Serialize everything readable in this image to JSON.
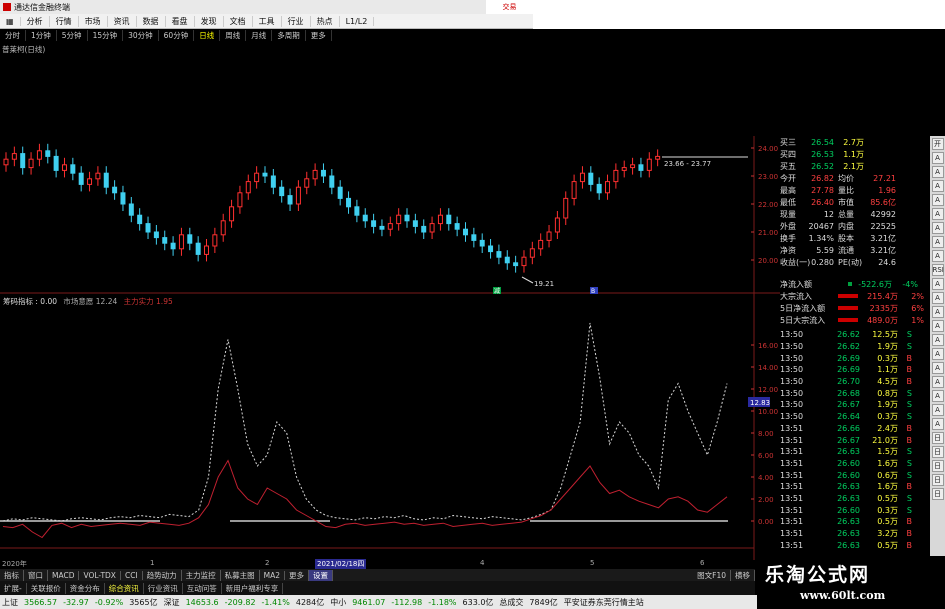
{
  "titlebar": {
    "title": "通达信金融终端"
  },
  "menu": {
    "items": [
      "分析",
      "行情",
      "市场",
      "资讯",
      "数据",
      "看盘",
      "发现",
      "文档",
      "工具",
      "行业",
      "热点",
      "L1/L2"
    ],
    "brand": "交易"
  },
  "periods": {
    "items": [
      "分时",
      "1分钟",
      "5分钟",
      "15分钟",
      "30分钟",
      "60分钟",
      "日线",
      "周线",
      "月线",
      "多周期",
      "更多"
    ],
    "active": 6
  },
  "stock": {
    "name": "普莱柯(日线)"
  },
  "kline": {
    "price_axis": [
      "24.00",
      "23.00",
      "22.00",
      "21.00",
      "20.00"
    ],
    "high_label": "23.66 - 23.77",
    "low_label": "19.21",
    "low_marker": "减",
    "event_marker": "B"
  },
  "indicator": {
    "name": "筹码指标",
    "v0_label": ": 0.00",
    "m1_label": "市场意愿 12.24",
    "m2_label": "主力实力 1.95",
    "axis": [
      "16.00",
      "14.00",
      "12.00",
      "10.00",
      "8.00",
      "6.00",
      "4.00",
      "2.00",
      "0.00"
    ],
    "current": "12.83",
    "chart_data": {
      "type": "line",
      "series": [
        {
          "name": "市场意愿",
          "values": [
            0,
            0.2,
            0.1,
            0.3,
            0.2,
            0.1,
            0,
            0.2,
            0.3,
            0.2,
            0.1,
            0.3,
            0.4,
            0.3,
            0.5,
            0.4,
            0.3,
            0.6,
            0.5,
            0.4,
            1.0,
            4.0,
            12.0,
            16.5,
            12.0,
            7.0,
            5.0,
            6.0,
            9.0,
            8.0,
            4.0,
            2.0,
            1.0,
            0.5,
            0.3,
            0.2,
            0.1,
            0.3,
            0.2,
            0.4,
            0.3,
            0.5,
            0.2,
            0.1,
            0.3,
            0.2,
            0.5,
            0.4,
            0.3,
            0.2,
            0.4,
            0.3,
            0.2,
            0.1,
            0.3,
            0.6,
            1.0,
            3.0,
            6.0,
            9.0,
            18.0,
            13.0,
            7.0,
            9.0,
            8.0,
            6.0,
            5.0,
            3.0,
            11.0,
            12.5,
            10.0,
            8.0,
            6.0,
            9.0,
            12.5
          ]
        },
        {
          "name": "主力实力",
          "values": [
            -0.5,
            -0.6,
            -0.3,
            -1.0,
            -1.5,
            -0.4,
            -0.2,
            -0.6,
            -0.3,
            -0.5,
            -0.4,
            -0.3,
            -0.2,
            -0.3,
            -0.4,
            -0.1,
            -0.2,
            -0.3,
            -0.4,
            -0.2,
            0.3,
            1.5,
            4.0,
            5.5,
            3.0,
            2.0,
            1.5,
            3.0,
            2.5,
            2.0,
            1.0,
            0.5,
            0.0,
            -0.5,
            -0.6,
            -0.3,
            -0.2,
            -0.4,
            -0.3,
            -0.2,
            -0.1,
            -0.3,
            -0.2,
            -0.4,
            -0.3,
            -0.2,
            -0.5,
            -0.4,
            -0.3,
            -0.2,
            -0.4,
            -0.3,
            -0.2,
            -0.1,
            0.2,
            0.5,
            1.0,
            2.0,
            3.0,
            4.0,
            5.0,
            3.5,
            2.5,
            2.8,
            2.2,
            1.8,
            1.5,
            1.2,
            2.0,
            2.2,
            1.8,
            1.0,
            0.8,
            1.5,
            2.2
          ]
        }
      ],
      "ylim": [
        -2,
        18
      ]
    }
  },
  "quote": {
    "rows": [
      {
        "l": "买三",
        "v1": "26.54",
        "v2": "2.7万"
      },
      {
        "l": "买四",
        "v1": "26.53",
        "v2": "1.1万"
      },
      {
        "l": "买五",
        "v1": "26.52",
        "v2": "2.1万"
      }
    ],
    "stats": [
      {
        "l1": "今开",
        "v1": "26.82",
        "l2": "均价",
        "v2": "27.21"
      },
      {
        "l1": "最高",
        "v1": "27.78",
        "l2": "量比",
        "v2": "1.96"
      },
      {
        "l1": "最低",
        "v1": "26.40",
        "l2": "市值",
        "v2": "85.6亿"
      },
      {
        "l1": "现量",
        "v1": "12",
        "l2": "总量",
        "v2": "42992"
      },
      {
        "l1": "外盘",
        "v1": "20467",
        "l2": "内盘",
        "v2": "22525"
      },
      {
        "l1": "换手",
        "v1": "1.34%",
        "l2": "股本",
        "v2": "3.21亿"
      },
      {
        "l1": "净资",
        "v1": "5.59",
        "l2": "流通",
        "v2": "3.21亿"
      },
      {
        "l1": "收益(一)",
        "v1": "0.280",
        "l2": "PE(动)",
        "v2": "24.6"
      }
    ]
  },
  "flow": {
    "rows": [
      {
        "l": "净流入额",
        "v": "-522.6万",
        "p": "-4%"
      },
      {
        "l": "大宗流入",
        "v": "215.4万",
        "p": "2%"
      },
      {
        "l": "5日净流入额",
        "v": "2335万",
        "p": "6%"
      },
      {
        "l": "5日大宗流入",
        "v": "489.0万",
        "p": "1%"
      }
    ]
  },
  "ticks": [
    {
      "t": "13:50",
      "p": "26.62",
      "v": "12.5万",
      "s": "S"
    },
    {
      "t": "13:50",
      "p": "26.62",
      "v": "1.9万",
      "s": "S"
    },
    {
      "t": "13:50",
      "p": "26.69",
      "v": "0.3万",
      "s": "B"
    },
    {
      "t": "13:50",
      "p": "26.69",
      "v": "1.1万",
      "s": "B"
    },
    {
      "t": "13:50",
      "p": "26.70",
      "v": "4.5万",
      "s": "B"
    },
    {
      "t": "13:50",
      "p": "26.68",
      "v": "0.8万",
      "s": "S"
    },
    {
      "t": "13:50",
      "p": "26.67",
      "v": "1.9万",
      "s": "S"
    },
    {
      "t": "13:50",
      "p": "26.64",
      "v": "0.3万",
      "s": "S"
    },
    {
      "t": "13:51",
      "p": "26.66",
      "v": "2.4万",
      "S": "B",
      "s": "B"
    },
    {
      "t": "13:51",
      "p": "26.67",
      "v": "21.0万",
      "s": "B"
    },
    {
      "t": "13:51",
      "p": "26.63",
      "v": "1.5万",
      "s": "S"
    },
    {
      "t": "13:51",
      "p": "26.60",
      "v": "1.6万",
      "s": "S"
    },
    {
      "t": "13:51",
      "p": "26.60",
      "v": "0.6万",
      "s": "S"
    },
    {
      "t": "13:51",
      "p": "26.63",
      "v": "1.6万",
      "s": "B"
    },
    {
      "t": "13:51",
      "p": "26.63",
      "v": "0.5万",
      "s": "S"
    },
    {
      "t": "13:51",
      "p": "26.60",
      "v": "0.3万",
      "s": "S"
    },
    {
      "t": "13:51",
      "p": "26.63",
      "v": "0.5万",
      "s": "B"
    },
    {
      "t": "13:51",
      "p": "26.63",
      "v": "3.2万",
      "s": "B"
    },
    {
      "t": "13:51",
      "p": "26.63",
      "v": "0.5万",
      "s": "B"
    }
  ],
  "sidebar": {
    "items": [
      "开",
      "A",
      "A",
      "A",
      "A",
      "A",
      "A",
      "A",
      "A",
      "RSI",
      "A",
      "A",
      "A",
      "A",
      "A",
      "A",
      "A",
      "A",
      "A",
      "A",
      "A",
      "日",
      "日",
      "日",
      "日",
      "日"
    ]
  },
  "dates": {
    "items": [
      "2020年",
      "1",
      "2",
      "2021/02/18",
      "3",
      "4",
      "5",
      "6"
    ],
    "highlight": "2021/02/18四"
  },
  "tabs": {
    "items": [
      "指标",
      "窗口",
      "MACD",
      "VOL-TDX",
      "CCI",
      "趋势动力",
      "主力监控",
      "私募主图",
      "MA2",
      "更多",
      "设置"
    ],
    "sub": [
      "扩展-",
      "关联报价",
      "资金分布",
      "综合资讯",
      "行业资讯",
      "互动问答",
      "新用户福利专享"
    ],
    "right": "图文F10",
    "switch": "横移"
  },
  "status": {
    "sh_label": "上证",
    "sh_val": "3566.57",
    "sh_chg": "-32.97",
    "sh_pct": "-0.92%",
    "sh_amt": "3565亿",
    "sz_label": "深证",
    "sz_val": "14653.6",
    "sz_chg": "-209.82",
    "sz_pct": "-1.41%",
    "sz_amt": "4284亿",
    "zx_label": "中小",
    "zx_val": "9461.07",
    "zx_chg": "-112.98",
    "zx_pct": "-1.18%",
    "zx_amt": "633.0亿",
    "tot_label": "总成交",
    "tot_val": "7849亿",
    "broker": "平安证券东莞行情主站"
  },
  "watermark": {
    "line1": "乐淘公式网",
    "line2": "www.60lt.com"
  }
}
